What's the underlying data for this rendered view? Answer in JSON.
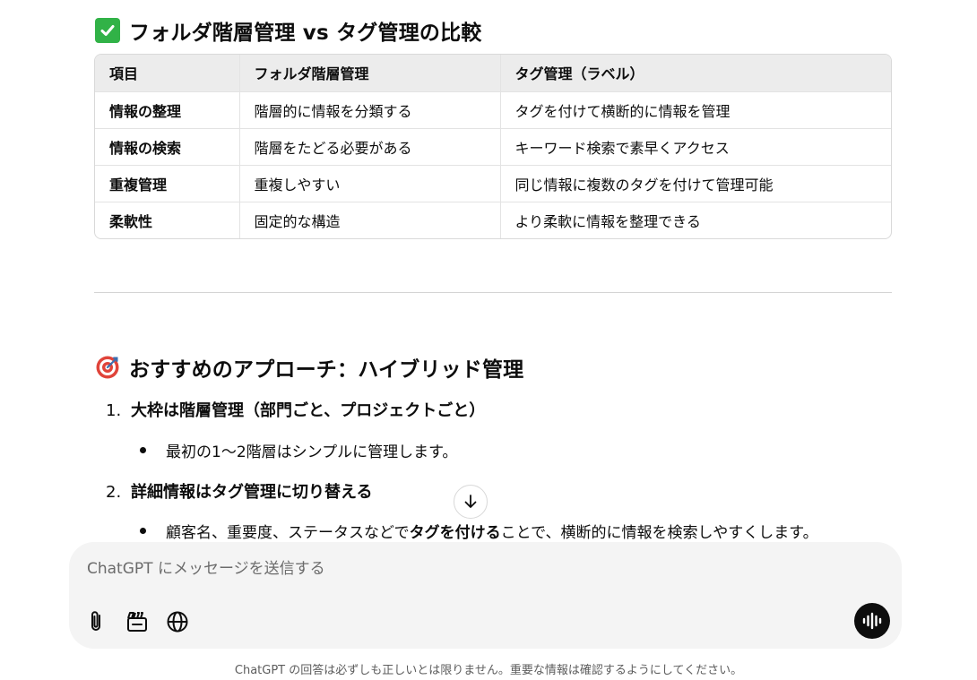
{
  "section1": {
    "title": "フォルダ階層管理 vs タグ管理の比較",
    "emoji": "check-mark-button-icon"
  },
  "table": {
    "headers": [
      "項目",
      "フォルダ階層管理",
      "タグ管理（ラベル）"
    ],
    "rows": [
      [
        "情報の整理",
        "階層的に情報を分類する",
        "タグを付けて横断的に情報を管理"
      ],
      [
        "情報の検索",
        "階層をたどる必要がある",
        "キーワード検索で素早くアクセス"
      ],
      [
        "重複管理",
        "重複しやすい",
        "同じ情報に複数のタグを付けて管理可能"
      ],
      [
        "柔軟性",
        "固定的な構造",
        "より柔軟に情報を整理できる"
      ]
    ]
  },
  "section2": {
    "title": "おすすめのアプローチ：ハイブリッド管理",
    "emoji": "bullseye-icon"
  },
  "list": {
    "item1": {
      "num": "1.",
      "bold": "大枠は階層管理（部門ごと、プロジェクトごと）"
    },
    "item1_bullet": "最初の1〜2階層はシンプルに管理します。",
    "item2": {
      "num": "2.",
      "bold1": "詳細情報は",
      "bold2": "タグ管理に切り替える"
    },
    "item2_bullet": {
      "pre": "顧客名、重要度、ステータスなどで",
      "bold": "タグを付ける",
      "post": "ことで、横断的に情報を検索しやすくします。"
    }
  },
  "composer": {
    "placeholder": "ChatGPT にメッセージを送信する",
    "tools": [
      "paperclip-icon",
      "clapperboard-icon",
      "globe-icon"
    ],
    "voice": "voice-mode-icon"
  },
  "footer": {
    "disclaimer": "ChatGPT の回答は必ずしも正しいとは限りません。重要な情報は確認するようにしてください。"
  },
  "colors": {
    "check_green": "#31b247",
    "target_red": "#e0443a",
    "accent_black": "#0d0d0d"
  }
}
